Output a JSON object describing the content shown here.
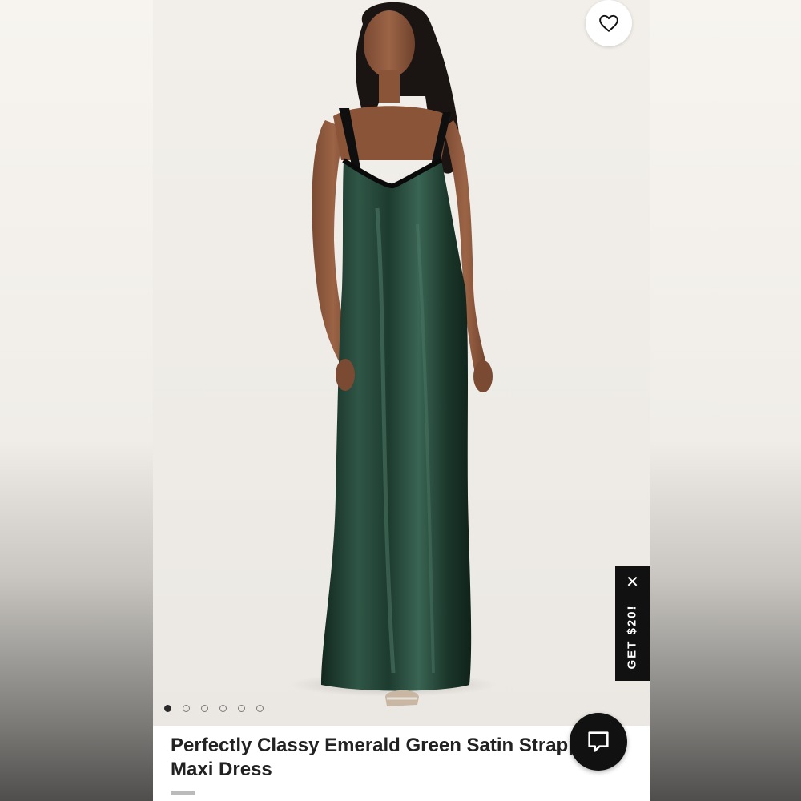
{
  "product": {
    "title": "Perfectly Classy Emerald Green Satin Strappy Maxi Dress"
  },
  "gallery": {
    "image_count": 6,
    "active_index": 0
  },
  "promo": {
    "label": "GET $20!",
    "close_icon": "close-icon"
  },
  "icons": {
    "favorite": "heart-icon",
    "chat": "chat-bubble-icon"
  },
  "colors": {
    "dress": "#1f3d31",
    "promo_bg": "#111111",
    "chat_bg": "#111111"
  }
}
